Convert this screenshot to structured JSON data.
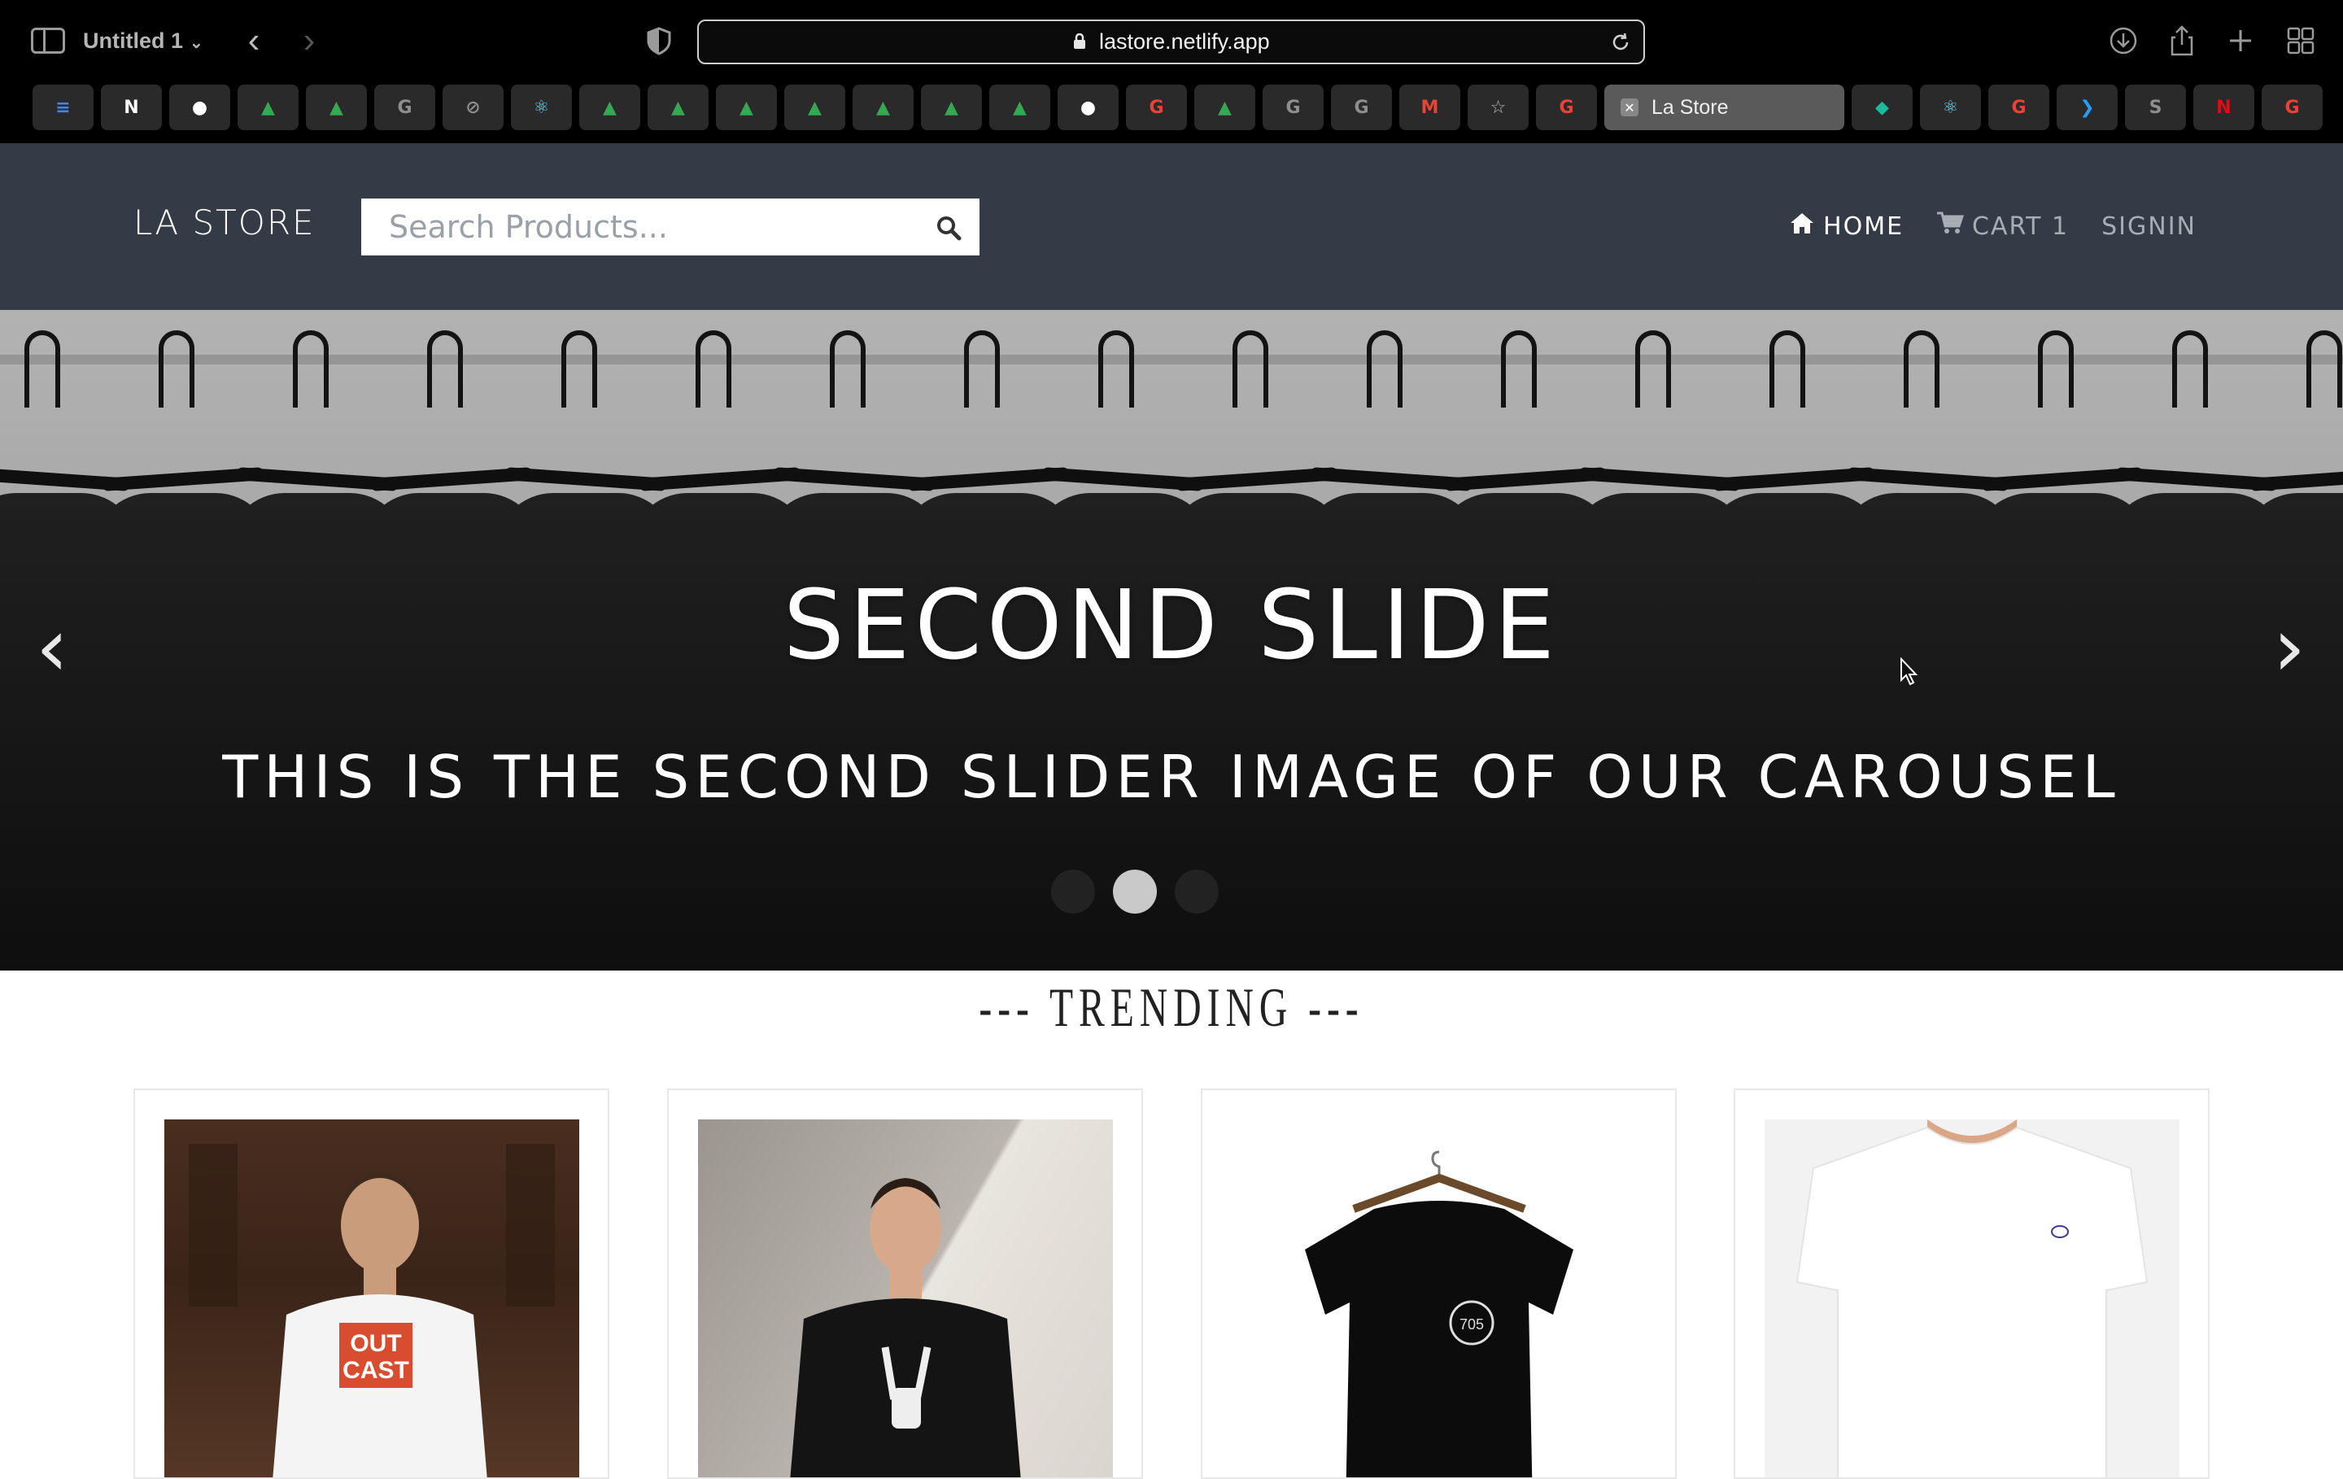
{
  "browser": {
    "window_title": "Untitled 1",
    "url": "lastore.netlify.app",
    "active_tab_label": "La Store",
    "favorites": [
      {
        "icon": "google-docs-icon",
        "glyph": "≡",
        "color": "#4285f4"
      },
      {
        "icon": "notion-icon",
        "glyph": "N",
        "color": "#ffffff"
      },
      {
        "icon": "github-icon",
        "glyph": "●",
        "color": "#ffffff"
      },
      {
        "icon": "google-drive-icon",
        "glyph": "▲",
        "color": "#34a853"
      },
      {
        "icon": "google-drive-icon",
        "glyph": "▲",
        "color": "#34a853"
      },
      {
        "icon": "generic-g-icon",
        "glyph": "G",
        "color": "#8e8e8e"
      },
      {
        "icon": "compass-icon",
        "glyph": "⊘",
        "color": "#8e8e8e"
      },
      {
        "icon": "react-icon",
        "glyph": "⚛",
        "color": "#61dafb"
      },
      {
        "icon": "google-drive-icon",
        "glyph": "▲",
        "color": "#34a853"
      },
      {
        "icon": "google-drive-icon",
        "glyph": "▲",
        "color": "#34a853"
      },
      {
        "icon": "google-drive-icon",
        "glyph": "▲",
        "color": "#34a853"
      },
      {
        "icon": "google-drive-icon",
        "glyph": "▲",
        "color": "#34a853"
      },
      {
        "icon": "google-drive-icon",
        "glyph": "▲",
        "color": "#34a853"
      },
      {
        "icon": "google-drive-icon",
        "glyph": "▲",
        "color": "#34a853"
      },
      {
        "icon": "google-drive-icon",
        "glyph": "▲",
        "color": "#34a853"
      },
      {
        "icon": "github-icon",
        "glyph": "●",
        "color": "#ffffff"
      },
      {
        "icon": "google-icon",
        "glyph": "G",
        "color": "#ea4335"
      },
      {
        "icon": "google-drive-icon",
        "glyph": "▲",
        "color": "#34a853"
      },
      {
        "icon": "generic-g-icon",
        "glyph": "G",
        "color": "#8e8e8e"
      },
      {
        "icon": "generic-g-icon",
        "glyph": "G",
        "color": "#8e8e8e"
      },
      {
        "icon": "gmail-icon",
        "glyph": "M",
        "color": "#ea4335"
      },
      {
        "icon": "star-icon",
        "glyph": "☆",
        "color": "#bbbbbb"
      },
      {
        "icon": "google-icon",
        "glyph": "G",
        "color": "#ea4335"
      }
    ],
    "favorites_after": [
      {
        "icon": "diamond-icon",
        "glyph": "◆",
        "color": "#1abc9c"
      },
      {
        "icon": "react-icon",
        "glyph": "⚛",
        "color": "#61dafb"
      },
      {
        "icon": "google-icon",
        "glyph": "G",
        "color": "#ea4335"
      },
      {
        "icon": "vscode-icon",
        "glyph": "❯",
        "color": "#2b9cf2"
      },
      {
        "icon": "generic-s-icon",
        "glyph": "S",
        "color": "#8e8e8e"
      },
      {
        "icon": "netflix-icon",
        "glyph": "N",
        "color": "#e50914"
      },
      {
        "icon": "google-icon",
        "glyph": "G",
        "color": "#ea4335"
      }
    ]
  },
  "site": {
    "brand": "LA STORE",
    "search_placeholder": "Search Products...",
    "nav": {
      "home": "HOME",
      "cart": "CART 1",
      "signin": "SIGNIN"
    },
    "colors": {
      "navbar": "#343a46",
      "nav_active": "#ffffff",
      "nav_inactive": "#a8adb5"
    }
  },
  "carousel": {
    "title": "SECOND SLIDE",
    "subtitle": "THIS IS THE SECOND SLIDER IMAGE OF OUR CAROUSEL",
    "prev": "‹",
    "next": "›",
    "slide_count": 3,
    "active_index": 1
  },
  "trending": {
    "heading": "--- TRENDING ---"
  }
}
